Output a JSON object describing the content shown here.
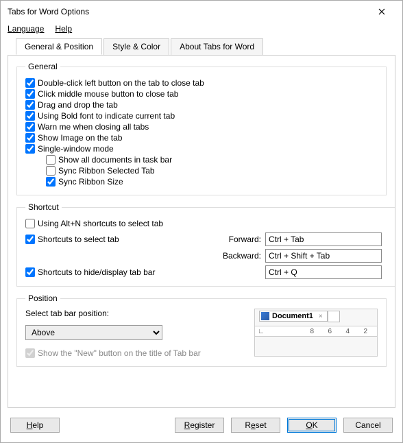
{
  "window": {
    "title": "Tabs for Word Options"
  },
  "menubar": {
    "language": "Language",
    "help": "Help"
  },
  "tabs": {
    "general": "General & Position",
    "style": "Style & Color",
    "about": "About Tabs for Word"
  },
  "group_general": {
    "legend": "General",
    "opt1": "Double-click left button on the tab to close tab",
    "opt2": "Click middle mouse button to close tab",
    "opt3": "Drag and drop the tab",
    "opt4": "Using Bold font to indicate current tab",
    "opt5": "Warn me when closing all tabs",
    "opt6": "Show Image on the tab",
    "opt7": "Single-window mode",
    "opt7a": "Show all documents in task bar",
    "opt7b": "Sync Ribbon Selected Tab",
    "opt7c": "Sync Ribbon Size"
  },
  "group_shortcut": {
    "legend": "Shortcut",
    "opt1": "Using Alt+N shortcuts to select tab",
    "opt2": "Shortcuts to select tab",
    "opt3": "Shortcuts to hide/display tab bar",
    "forward_label": "Forward:",
    "backward_label": "Backward:",
    "forward_value": "Ctrl + Tab",
    "backward_value": "Ctrl + Shift + Tab",
    "hide_value": "Ctrl + Q"
  },
  "group_position": {
    "legend": "Position",
    "select_label": "Select tab bar position:",
    "select_value": "Above",
    "show_new": "Show the \"New\" button on the title of Tab bar",
    "preview_doc": "Document1",
    "ruler": {
      "n8": "8",
      "n6": "6",
      "n4": "4",
      "n2": "2"
    }
  },
  "buttons": {
    "help": "Help",
    "register": "Register",
    "reset": "Reset",
    "ok": "OK",
    "cancel": "Cancel"
  }
}
